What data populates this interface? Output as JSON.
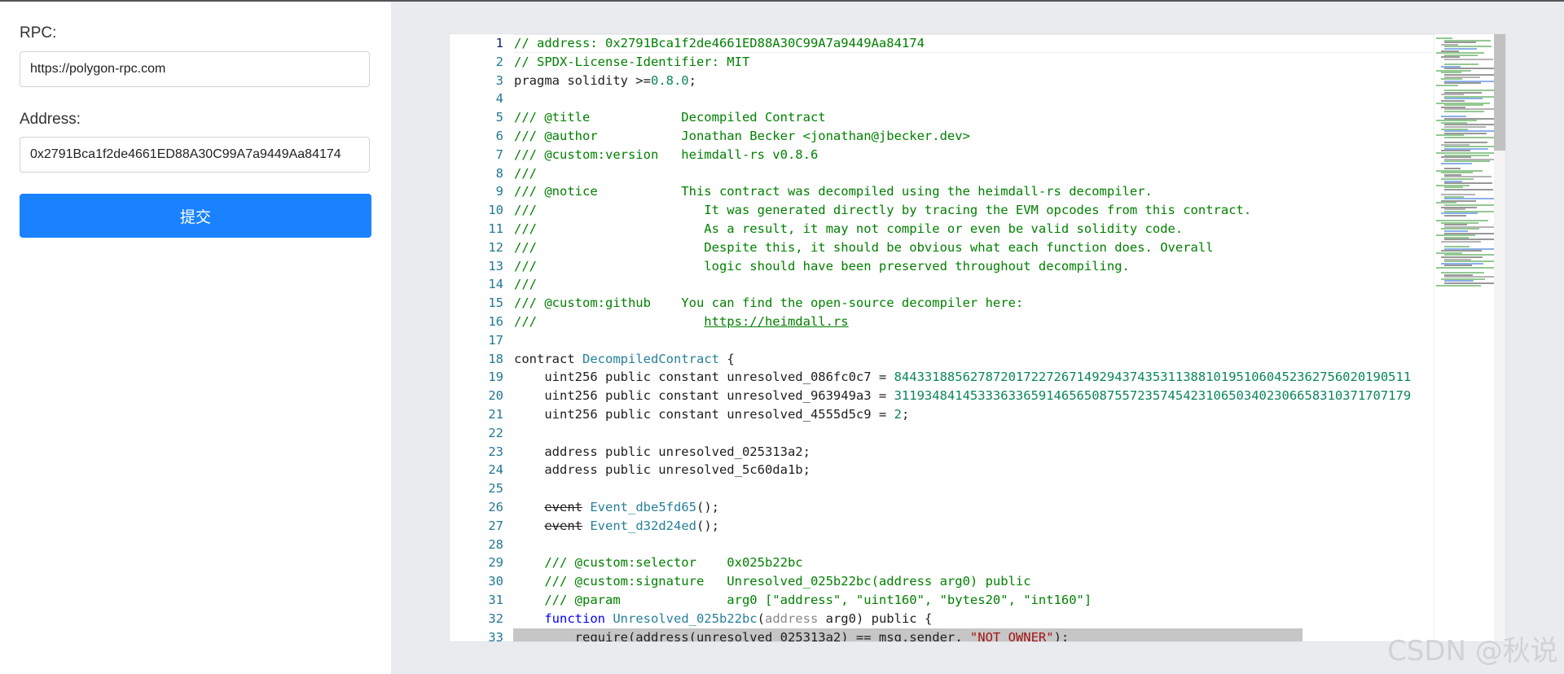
{
  "form": {
    "rpc_label": "RPC:",
    "rpc_value": "https://polygon-rpc.com",
    "address_label": "Address:",
    "address_value": "0x2791Bca1f2de4661ED88A30C99A7a9449Aa84174",
    "submit_label": "提交"
  },
  "editor": {
    "active_line": 1,
    "selected_line": 33,
    "lines": [
      {
        "n": "1",
        "parts": [
          {
            "t": "// address: 0x2791Bca1f2de4661ED88A30C99A7a9449Aa84174",
            "c": "cm"
          }
        ]
      },
      {
        "n": "2",
        "parts": [
          {
            "t": "// SPDX-License-Identifier: MIT",
            "c": "cm"
          }
        ]
      },
      {
        "n": "3",
        "parts": [
          {
            "t": "pragma solidity >=",
            "c": ""
          },
          {
            "t": "0.8.0",
            "c": "n"
          },
          {
            "t": ";",
            "c": ""
          }
        ]
      },
      {
        "n": "4",
        "parts": []
      },
      {
        "n": "5",
        "parts": [
          {
            "t": "/// @title            Decompiled Contract",
            "c": "cm"
          }
        ]
      },
      {
        "n": "6",
        "parts": [
          {
            "t": "/// @author           Jonathan Becker <jonathan@jbecker.dev>",
            "c": "cm"
          }
        ]
      },
      {
        "n": "7",
        "parts": [
          {
            "t": "/// @custom:version   heimdall-rs v0.8.6",
            "c": "cm"
          }
        ]
      },
      {
        "n": "8",
        "parts": [
          {
            "t": "///",
            "c": "cm"
          }
        ]
      },
      {
        "n": "9",
        "parts": [
          {
            "t": "/// @notice           This contract was decompiled using the heimdall-rs decompiler.",
            "c": "cm"
          }
        ]
      },
      {
        "n": "10",
        "parts": [
          {
            "t": "///                      It was generated directly by tracing the EVM opcodes from this contract.",
            "c": "cm"
          }
        ]
      },
      {
        "n": "11",
        "parts": [
          {
            "t": "///                      As a result, it may not compile or even be valid solidity code.",
            "c": "cm"
          }
        ]
      },
      {
        "n": "12",
        "parts": [
          {
            "t": "///                      Despite this, it should be obvious what each function does. Overall",
            "c": "cm"
          }
        ]
      },
      {
        "n": "13",
        "parts": [
          {
            "t": "///                      logic should have been preserved throughout decompiling.",
            "c": "cm"
          }
        ]
      },
      {
        "n": "14",
        "parts": [
          {
            "t": "///",
            "c": "cm"
          }
        ]
      },
      {
        "n": "15",
        "parts": [
          {
            "t": "/// @custom:github    You can find the open-source decompiler here:",
            "c": "cm"
          }
        ]
      },
      {
        "n": "16",
        "parts": [
          {
            "t": "///                      ",
            "c": "cm"
          },
          {
            "t": "https://heimdall.rs",
            "c": "cm u"
          }
        ]
      },
      {
        "n": "17",
        "parts": []
      },
      {
        "n": "18",
        "parts": [
          {
            "t": "contract ",
            "c": ""
          },
          {
            "t": "DecompiledContract",
            "c": "t"
          },
          {
            "t": " {",
            "c": ""
          }
        ]
      },
      {
        "n": "19",
        "parts": [
          {
            "t": "    uint256 public constant unresolved_086fc0c7 = ",
            "c": ""
          },
          {
            "t": "84433188562787201722726714929437435311388101951060452362756020190511",
            "c": "n"
          }
        ]
      },
      {
        "n": "20",
        "parts": [
          {
            "t": "    uint256 public constant unresolved_963949a3 = ",
            "c": ""
          },
          {
            "t": "31193484145333633659146565087557235745423106503402306658310371707179",
            "c": "n"
          }
        ]
      },
      {
        "n": "21",
        "parts": [
          {
            "t": "    uint256 public constant unresolved_4555d5c9 = ",
            "c": ""
          },
          {
            "t": "2",
            "c": "n"
          },
          {
            "t": ";",
            "c": ""
          }
        ]
      },
      {
        "n": "22",
        "parts": []
      },
      {
        "n": "23",
        "parts": [
          {
            "t": "    address public unresolved_025313a2;",
            "c": ""
          }
        ]
      },
      {
        "n": "24",
        "parts": [
          {
            "t": "    address public unresolved_5c60da1b;",
            "c": ""
          }
        ]
      },
      {
        "n": "25",
        "parts": []
      },
      {
        "n": "26",
        "parts": [
          {
            "t": "    ",
            "c": ""
          },
          {
            "t": "event",
            "c": "st"
          },
          {
            "t": " ",
            "c": ""
          },
          {
            "t": "Event_dbe5fd65",
            "c": "t"
          },
          {
            "t": "();",
            "c": ""
          }
        ]
      },
      {
        "n": "27",
        "parts": [
          {
            "t": "    ",
            "c": ""
          },
          {
            "t": "event",
            "c": "st"
          },
          {
            "t": " ",
            "c": ""
          },
          {
            "t": "Event_d32d24ed",
            "c": "t"
          },
          {
            "t": "();",
            "c": ""
          }
        ]
      },
      {
        "n": "28",
        "parts": []
      },
      {
        "n": "29",
        "parts": [
          {
            "t": "    /// @custom:selector    0x025b22bc",
            "c": "cm"
          }
        ]
      },
      {
        "n": "30",
        "parts": [
          {
            "t": "    /// @custom:signature   Unresolved_025b22bc(address arg0) public",
            "c": "cm"
          }
        ]
      },
      {
        "n": "31",
        "parts": [
          {
            "t": "    /// @param              arg0 [\"address\", \"uint160\", \"bytes20\", \"int160\"]",
            "c": "cm"
          }
        ]
      },
      {
        "n": "32",
        "parts": [
          {
            "t": "    ",
            "c": ""
          },
          {
            "t": "function",
            "c": "k"
          },
          {
            "t": " ",
            "c": ""
          },
          {
            "t": "Unresolved_025b22bc",
            "c": "t"
          },
          {
            "t": "(",
            "c": ""
          },
          {
            "t": "address",
            "c": "g"
          },
          {
            "t": " arg0) public {",
            "c": ""
          }
        ]
      },
      {
        "n": "33",
        "parts": [
          {
            "t": "        require(address(unresolved_025313a2) == msg.sender, ",
            "c": ""
          },
          {
            "t": "\"NOT OWNER\"",
            "c": "s"
          },
          {
            "t": ");",
            "c": ""
          }
        ]
      }
    ]
  },
  "watermark": "CSDN @秋说"
}
